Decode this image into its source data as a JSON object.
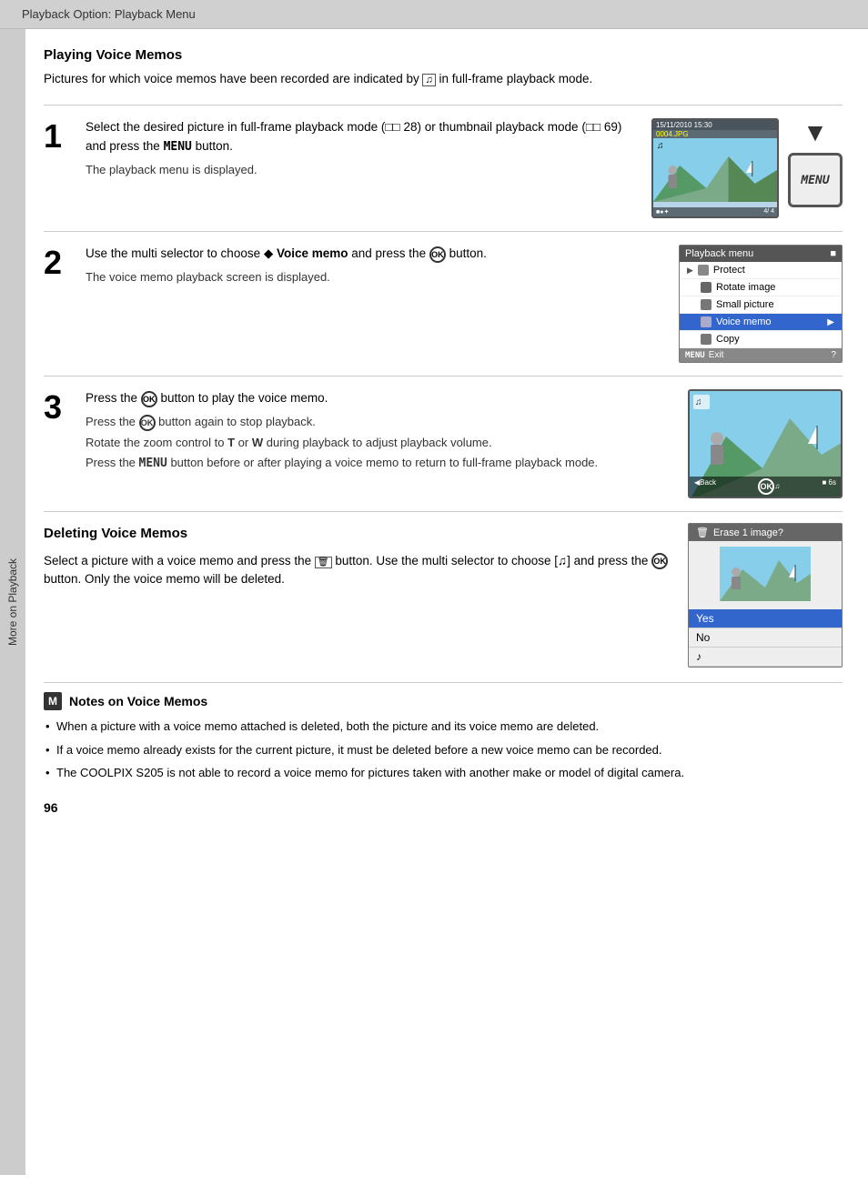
{
  "header": {
    "title": "Playback Option: Playback Menu"
  },
  "sidebar": {
    "label": "More on Playback"
  },
  "section1": {
    "heading": "Playing Voice Memos",
    "intro": "Pictures for which voice memos have been recorded are indicated by  in full-frame playback mode."
  },
  "steps": [
    {
      "number": "1",
      "text": "Select the desired picture in full-frame playback mode (□□ 28) or thumbnail playback mode (□□ 69) and press the MENU button.",
      "note": "The playback menu is displayed.",
      "camera_timestamp": "15/11/2010 15:30",
      "camera_filename": "0004.JPG",
      "camera_count": "4/ 4"
    },
    {
      "number": "2",
      "text": "Use the multi selector to choose  Voice memo and press the  button.",
      "note": "The voice memo playback screen is displayed.",
      "menu_title": "Playback menu",
      "menu_items": [
        {
          "label": "Protect",
          "icon": "protect-icon",
          "active": false
        },
        {
          "label": "Rotate image",
          "icon": "rotate-icon",
          "active": false
        },
        {
          "label": "Small picture",
          "icon": "small-picture-icon",
          "active": false
        },
        {
          "label": "Voice memo",
          "icon": "voice-memo-icon",
          "active": true
        },
        {
          "label": "Copy",
          "icon": "copy-icon",
          "active": false
        }
      ],
      "menu_footer": "Exit"
    },
    {
      "number": "3",
      "text": "Press the  button to play the voice memo.",
      "notes": [
        "Press the  button again to stop playback.",
        "Rotate the zoom control to T or W during playback to adjust playback volume.",
        "Press the MENU button before or after playing a voice memo to return to full-frame playback mode."
      ],
      "playback_bar": "◀Back    ▶▶⎯⎯    6s"
    }
  ],
  "deleting": {
    "heading": "Deleting Voice Memos",
    "text": "Select a picture with a voice memo and press the  button. Use the multi selector to choose [ ] and press the  button. Only the voice memo will be deleted.",
    "dialog_title": "Erase 1 image?",
    "dialog_options": [
      "Yes",
      "No",
      "♪"
    ]
  },
  "notes": {
    "heading": "Notes on Voice Memos",
    "items": [
      "When a picture with a voice memo attached is deleted, both the picture and its voice memo are deleted.",
      "If a voice memo already exists for the current picture, it must be deleted before a new voice memo can be recorded.",
      "The COOLPIX S205 is not able to record a voice memo for pictures taken with another make or model of digital camera."
    ]
  },
  "page_number": "96"
}
